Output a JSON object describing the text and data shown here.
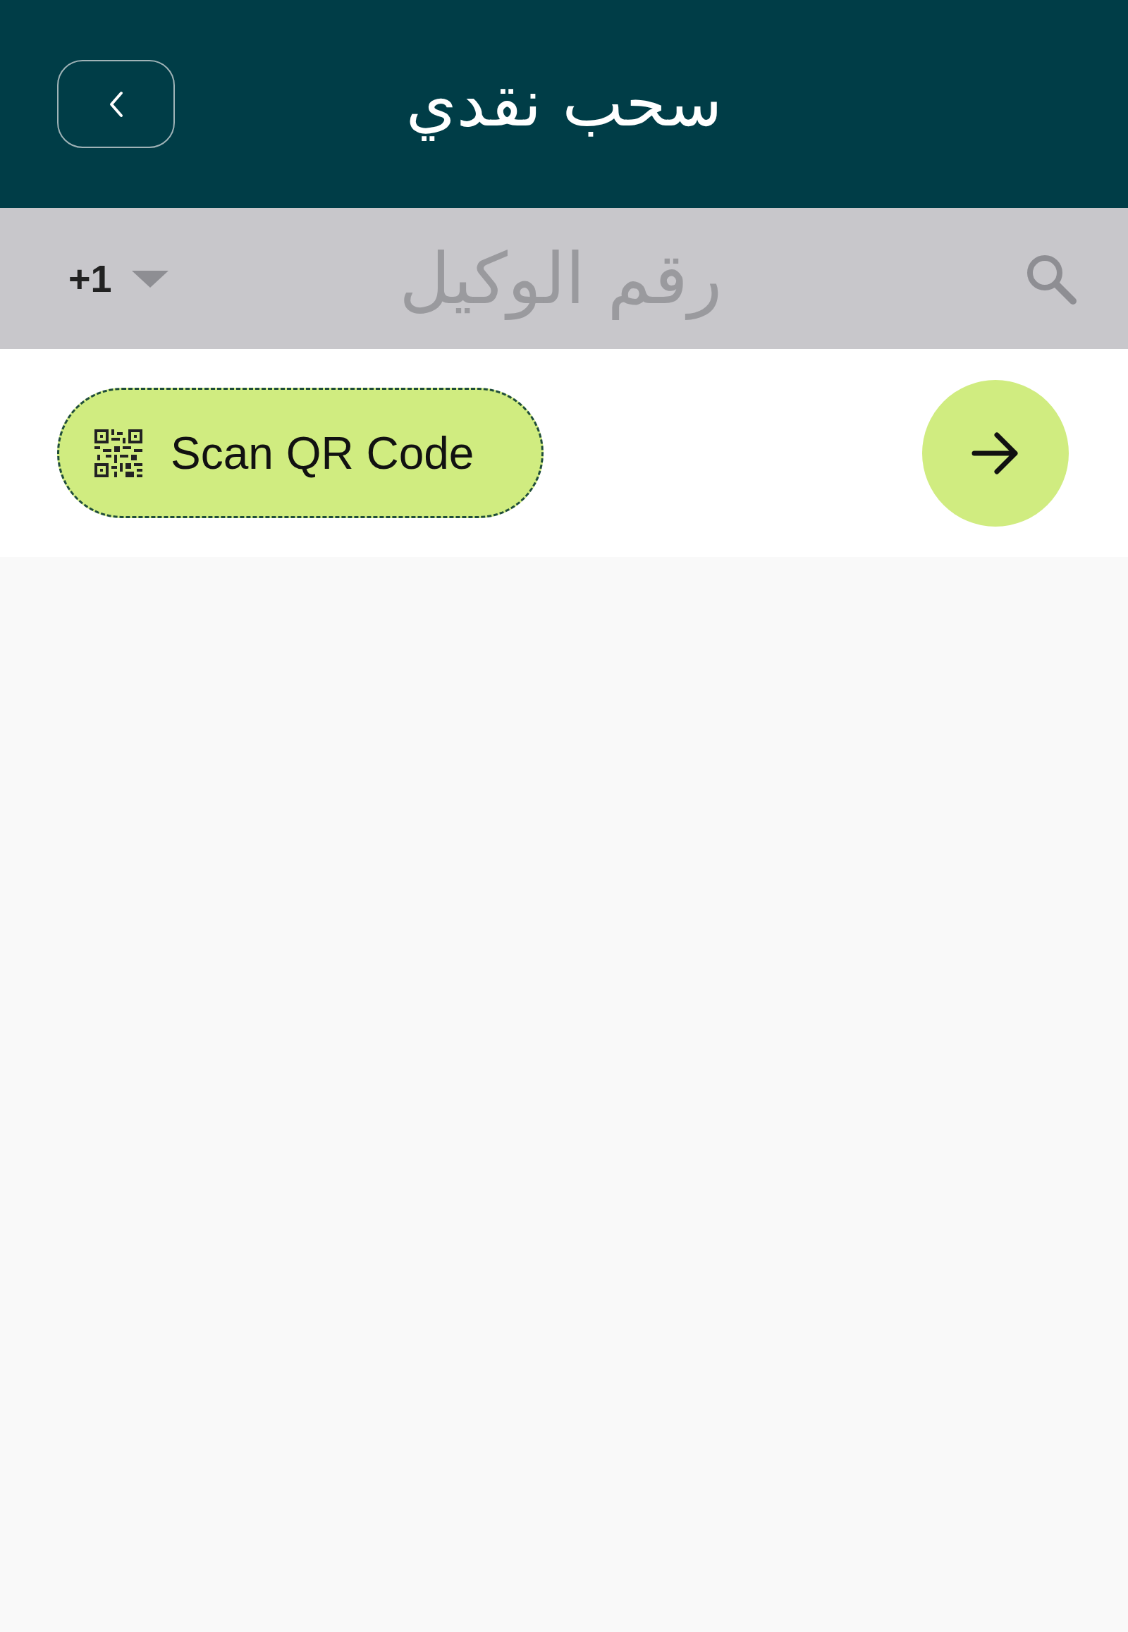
{
  "header": {
    "title": "سحب نقدي"
  },
  "search": {
    "country_code": "+1",
    "placeholder": "رقم الوكيل"
  },
  "scan_button": {
    "label": "Scan QR Code"
  }
}
